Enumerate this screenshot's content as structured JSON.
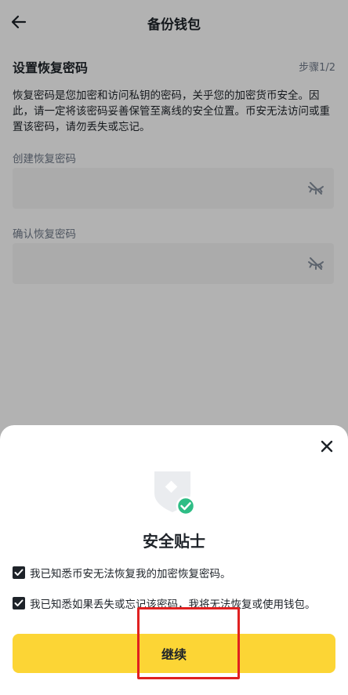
{
  "header": {
    "title": "备份钱包",
    "back_icon": "arrow-left-icon"
  },
  "section": {
    "title": "设置恢复密码",
    "step": "步骤1/2",
    "description": "恢复密码是您加密和访问私钥的密码，关乎您的加密货币安全。因此，请一定将该密码妥善保管至离线的安全位置。币安无法访问或重置该密码，请勿丢失或忘记。"
  },
  "fields": [
    {
      "label": "创建恢复密码",
      "value": "",
      "icon": "eye-off-icon"
    },
    {
      "label": "确认恢复密码",
      "value": "",
      "icon": "eye-off-icon"
    }
  ],
  "sheet": {
    "title": "安全贴士",
    "close_icon": "close-icon",
    "illustration": "shield-check-icon",
    "checkboxes": [
      {
        "label": "我已知悉币安无法恢复我的加密恢复密码。",
        "checked": true
      },
      {
        "label": "我已知悉如果丢失或忘记该密码，我将无法恢复或使用钱包。",
        "checked": true
      }
    ],
    "continue_label": "继续"
  },
  "colors": {
    "accent": "#fcd535",
    "success": "#2ebd85",
    "text": "#1e2329",
    "secondary": "#707a8a",
    "annotation": "#e02020"
  }
}
